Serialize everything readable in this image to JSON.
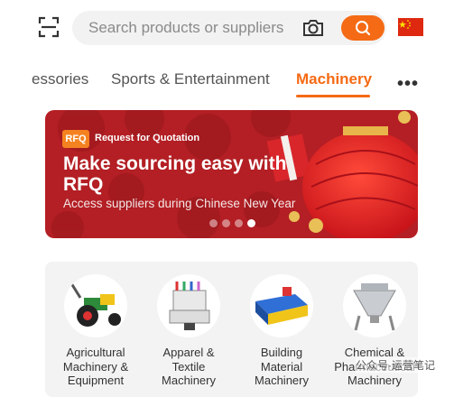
{
  "header": {
    "scan_icon": "scan-icon",
    "search_placeholder": "Search products or suppliers",
    "camera_icon": "camera-icon",
    "search_icon": "search-icon",
    "flag_icon": "china-flag-icon"
  },
  "tabs": {
    "items": [
      {
        "label": "essories",
        "active": false
      },
      {
        "label": "Sports & Entertainment",
        "active": false
      },
      {
        "label": "Machinery",
        "active": true
      }
    ],
    "more_icon": "more-icon"
  },
  "banner": {
    "logo_text": "RFQ",
    "badge_label": "Request for Quotation",
    "title": "Make sourcing easy with RFQ",
    "subtitle": "Access suppliers during Chinese New Year",
    "dots_count": 4,
    "active_dot_index": 3
  },
  "categories": [
    {
      "label": "Agricultural Machinery & Equipment",
      "icon": "tractor-icon"
    },
    {
      "label": "Apparel & Textile Machinery",
      "icon": "sewing-machine-icon"
    },
    {
      "label": "Building Material Machinery",
      "icon": "roll-forming-machine-icon"
    },
    {
      "label": "Chemical & Pharmaceutical Machinery",
      "icon": "mixer-machine-icon"
    }
  ],
  "watermark": "公众号·运营笔记",
  "colors": {
    "accent": "#f56a14",
    "banner_red": "#b31f24",
    "panel_bg": "#f3f3f3"
  }
}
